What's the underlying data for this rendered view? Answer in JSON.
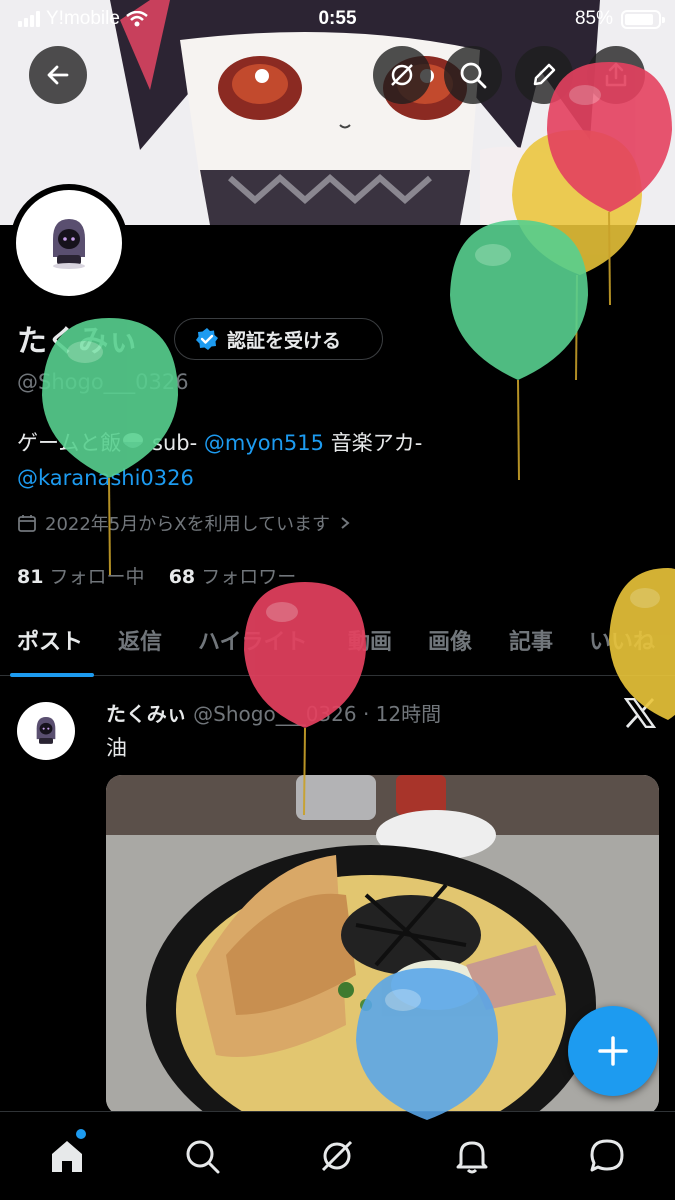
{
  "status_bar": {
    "carrier": "Y!mobile",
    "time": "0:55",
    "battery": "85%"
  },
  "profile": {
    "name": "たくみぃ",
    "verify_button": "認証を受ける",
    "handle": "@Shogo___0326",
    "bio_parts": {
      "text1": "ゲームと飯",
      "text2": " sub- ",
      "link1": "@myon515",
      "text3": " 音楽アカ-",
      "link2": "@karanashi0326"
    },
    "joined": "2022年5月からXを利用しています",
    "following_count": "81",
    "following_label": "フォロー中",
    "followers_count": "68",
    "followers_label": "フォロワー"
  },
  "tabs": [
    "ポスト",
    "返信",
    "ハイライト",
    "動画",
    "画像",
    "記事",
    "いいね"
  ],
  "post": {
    "author": "たくみぃ",
    "handle_time": "@Shogo___0326 · 12時間",
    "text": "油"
  },
  "icons": {
    "back": "back-arrow-icon",
    "grok": "grok-icon",
    "search": "search-icon",
    "edit": "pencil-icon",
    "share": "share-icon",
    "home": "home-icon",
    "notifications": "bell-icon",
    "messages": "message-icon",
    "compose": "plus-icon"
  },
  "colors": {
    "accent": "#1d9bf0",
    "background": "#000000",
    "secondary_text": "#71767b"
  }
}
